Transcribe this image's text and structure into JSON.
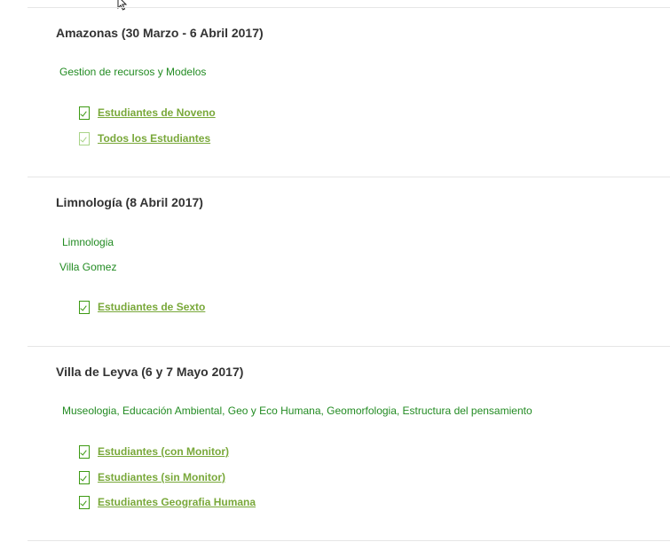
{
  "sections": [
    {
      "title": "Amazonas (30 Marzo - 6 Abril 2017)",
      "subtitles": [
        "Gestion de recursos y Modelos"
      ],
      "links": [
        "Estudiantes de Noveno",
        "Todos los Estudiantes"
      ]
    },
    {
      "title": "Limnología (8 Abril 2017)",
      "subtitles": [
        "Limnologia",
        "Villa Gomez"
      ],
      "links": [
        "Estudiantes de Sexto"
      ]
    },
    {
      "title": "Villa de Leyva (6 y 7 Mayo 2017)",
      "subtitles": [
        "Museologia, Educación Ambiental, Geo y Eco Humana, Geomorfologia, Estructura del pensamiento"
      ],
      "links": [
        "Estudiantes (con Monitor)",
        "Estudiantes (sin Monitor)",
        "Estudiantes Geografia Humana"
      ]
    }
  ],
  "icons": {
    "link_icon": "document-check-icon",
    "cursor": "mouse-pointer-icon"
  },
  "colors": {
    "title": "#333333",
    "subtitle": "#228b22",
    "link": "#79a83a",
    "icon": "#3d9a14",
    "divider": "#e6e6e6"
  }
}
